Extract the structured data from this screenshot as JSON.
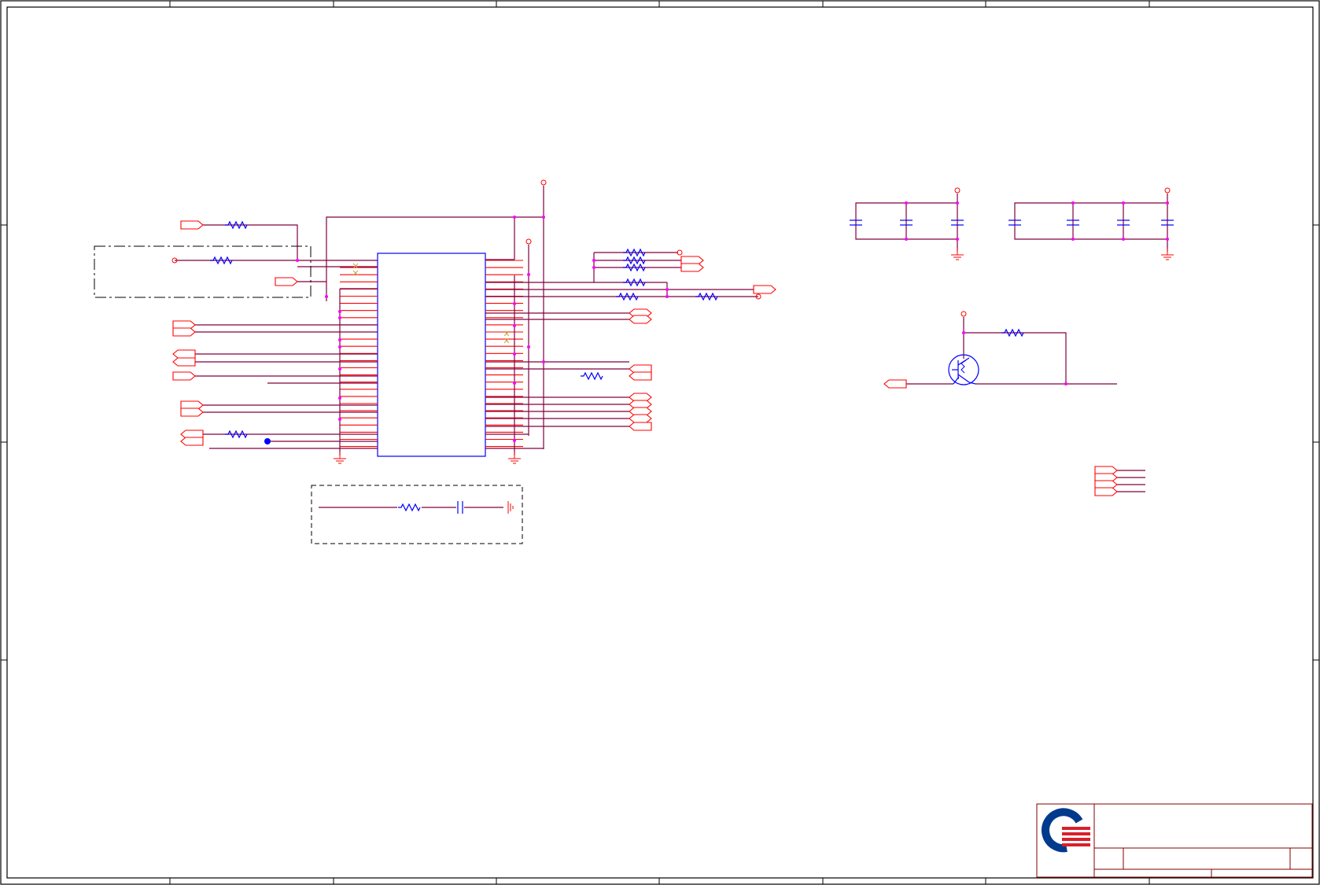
{
  "sheet": {
    "zone_markers": 3,
    "colors": {
      "border": "#000000",
      "wire": "#800040",
      "pin": "#ff0000",
      "component": "#0000ff",
      "junction": "#ff00ff",
      "power": "#ff0000",
      "title_block": "#800000",
      "logo_blue": "#003a8c",
      "logo_red": "#d9202a"
    }
  },
  "schematic": {
    "main_ic": {
      "left_pins": 27,
      "right_pins": 27
    },
    "left_ports": 9,
    "right_ports": 9,
    "decoupling_groups": 2,
    "transistor": "npn-icon",
    "bus_ports": 4
  },
  "title_block": {
    "logo": "qisda-logo-icon"
  }
}
